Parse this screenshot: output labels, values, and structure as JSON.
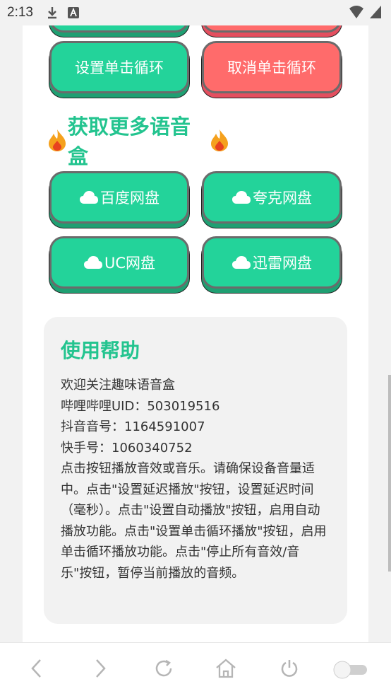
{
  "status_bar": {
    "time": "2:13"
  },
  "buttons_top": {
    "set_loop": "设置单击循环",
    "cancel_loop": "取消单击循环"
  },
  "section": {
    "title": "获取更多语音盒"
  },
  "disk_buttons": [
    {
      "label": "百度网盘"
    },
    {
      "label": "夸克网盘"
    },
    {
      "label": "UC网盘"
    },
    {
      "label": "迅雷网盘"
    }
  ],
  "help": {
    "title": "使用帮助",
    "lines": [
      "欢迎关注趣味语音盒",
      "哔哩哔哩UID：503019516",
      "抖音音号：1164591007",
      "快手号：1060340752"
    ],
    "paragraph": "点击按钮播放音效或音乐。请确保设备音量适中。点击\"设置延迟播放\"按钮，设置延迟时间（毫秒）。点击\"设置自动播放\"按钮，启用自动播放功能。点击\"设置单击循环播放\"按钮，启用单击循环播放功能。点击\"停止所有音效/音乐\"按钮，暂停当前播放的音频。"
  },
  "colors": {
    "green": "#23d39a",
    "red": "#ff6b6b",
    "title_green": "#23c48f"
  },
  "icons": [
    "download-icon",
    "app-a-icon",
    "wifi-icon",
    "signal-icon",
    "cloud-icon",
    "flame-icon",
    "back-icon",
    "forward-icon",
    "refresh-icon",
    "home-icon",
    "power-icon",
    "toggle-switch"
  ]
}
